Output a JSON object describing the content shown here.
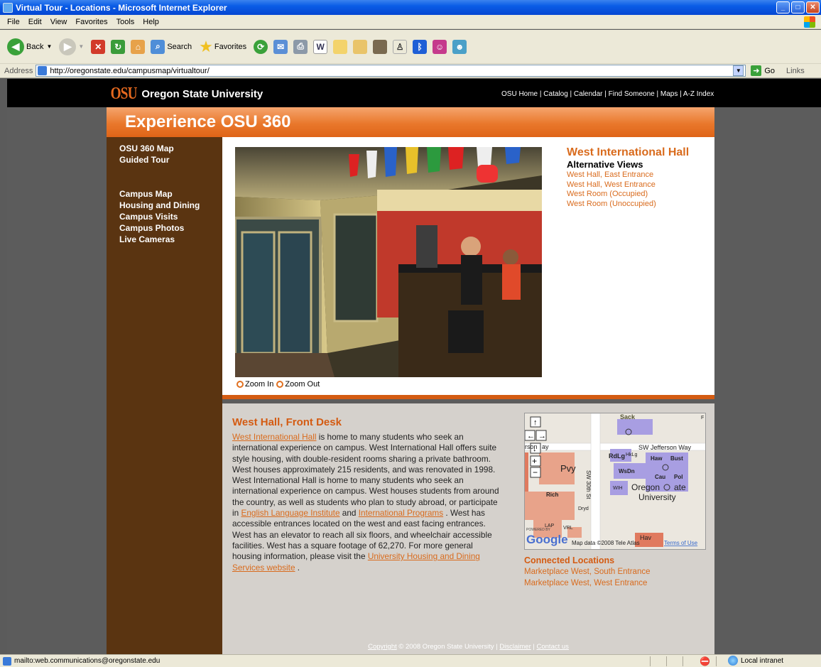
{
  "window": {
    "title": "Virtual Tour - Locations - Microsoft Internet Explorer"
  },
  "menubar": [
    "File",
    "Edit",
    "View",
    "Favorites",
    "Tools",
    "Help"
  ],
  "toolbar": {
    "back_label": "Back",
    "search_label": "Search",
    "favorites_label": "Favorites"
  },
  "addressbar": {
    "label": "Address",
    "url": "http://oregonstate.edu/campusmap/virtualtour/",
    "go_label": "Go",
    "links_label": "Links"
  },
  "header": {
    "logo_mark": "OSU",
    "logo_name": "Oregon State University",
    "links": [
      "OSU Home",
      "Catalog",
      "Calendar",
      "Find Someone",
      "Maps",
      "A-Z Index"
    ]
  },
  "banner": {
    "title": "Experience OSU 360"
  },
  "sidebar": {
    "group1": [
      "OSU 360 Map",
      "Guided Tour"
    ],
    "group2": [
      "Campus Map",
      "Housing and Dining",
      "Campus Visits",
      "Campus Photos",
      "Live Cameras"
    ]
  },
  "viewer": {
    "zoom_in": "Zoom In",
    "zoom_out": "Zoom Out"
  },
  "location": {
    "title": "West International Hall",
    "alt_heading": "Alternative Views",
    "alt_views": [
      "West Hall, East Entrance",
      "West Hall, West Entrance",
      "West Room (Occupied)",
      "West Room (Unoccupied)"
    ]
  },
  "description": {
    "heading": "West Hall, Front Desk",
    "link1": "West International Hall",
    "text1": " is home to many students who seek an international experience on campus. West International Hall offers suite style housing, with double-resident rooms sharing a private bathroom. West houses approximately 215 residents, and was renovated in 1998. West International Hall is home to many students who seek an international experience on campus. West houses students from around the country, as well as students who plan to study abroad, or participate in ",
    "link2": "English Language Institute",
    "text2": " and ",
    "link3": "International Programs",
    "text3": " . West has accessible entrances located on the west and east facing entrances. West has an elevator to reach all six floors, and wheelchair accessible facilities. West has a square footage of 62,270. For more general housing information, please visit the ",
    "link4": "University Housing and Dining Services website",
    "text4": " ."
  },
  "map": {
    "labels": {
      "sack": "Sack",
      "street": "SW Jefferson Way",
      "street_left": "rson",
      "street_left2": "ay",
      "rdlg": "RdLg",
      "hklg": "HkLg",
      "haw": "Haw",
      "bust": "Bust",
      "wsdn": "WsDn",
      "cau": "Cau",
      "pol": "Pol",
      "pvy": "Pvy",
      "rich": "Rich",
      "wih": "WIH",
      "osu1": "Oregon",
      "osu2": "ate",
      "osu3": "University",
      "sw30": "SW 30th St",
      "dryd": "Dryd",
      "lap": "LAP",
      "vrl": "VRL",
      "hav": "Hav",
      "powered": "POWERED BY",
      "google": "Google",
      "mapdata": "Map data ©2008 Tele Atlas",
      "terms": "Terms of Use",
      "f": "F"
    }
  },
  "connected": {
    "heading": "Connected Locations",
    "items": [
      "Marketplace West, South Entrance",
      "Marketplace West, West Entrance"
    ]
  },
  "footer": {
    "copyright": "Copyright",
    "text": " © 2008 Oregon State University | ",
    "disclaimer": "Disclaimer",
    "sep": " | ",
    "contact": "Contact us"
  },
  "statusbar": {
    "text": "mailto:web.communications@oregonstate.edu",
    "zone": "Local intranet"
  }
}
